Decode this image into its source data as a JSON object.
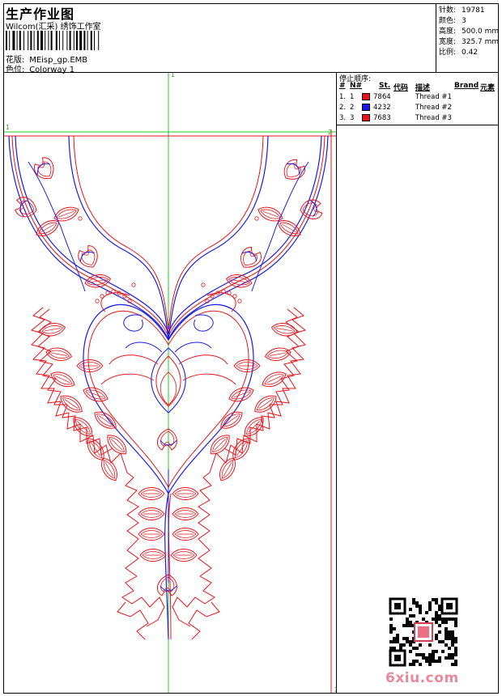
{
  "header": {
    "title": "生产作业图",
    "company": "Wilcom(汇采) 绣饰工作室",
    "barcode_label": "barcode",
    "design_label": "花版:",
    "design_value": "MEisp_gp.EMB",
    "colorway_label": "色位:",
    "colorway_value": "Colorway 1"
  },
  "specs": [
    {
      "label": "针数:",
      "value": "19781"
    },
    {
      "label": "颜色:",
      "value": "3"
    },
    {
      "label": "高度:",
      "value": "500.0 mm"
    },
    {
      "label": "宽度:",
      "value": "325.7 mm"
    },
    {
      "label": "比例:",
      "value": "0.42"
    }
  ],
  "thread_table": {
    "title": "停止顺序:",
    "headers": {
      "num": "#",
      "n": "N#",
      "st": "St.",
      "code": "代码",
      "desc": "描述",
      "brand": "Brand",
      "elem": "元素"
    },
    "rows": [
      {
        "num": "1.",
        "n": "1",
        "code": "7864",
        "desc": "Thread #1",
        "color": "#e8121a"
      },
      {
        "num": "2.",
        "n": "2",
        "code": "4232",
        "desc": "Thread #2",
        "color": "#1a1ae8"
      },
      {
        "num": "3.",
        "n": "3",
        "code": "7683",
        "desc": "Thread #3",
        "color": "#e8121a"
      }
    ]
  },
  "guides": {
    "h_label_left": "1",
    "h_label_right": "2",
    "v_label_top": "1",
    "v_label_bottom": "2"
  },
  "watermark": "6xiu.com",
  "colors": {
    "red": "#e8121a",
    "blue": "#1a1ae8",
    "guide": "#22cc22"
  }
}
